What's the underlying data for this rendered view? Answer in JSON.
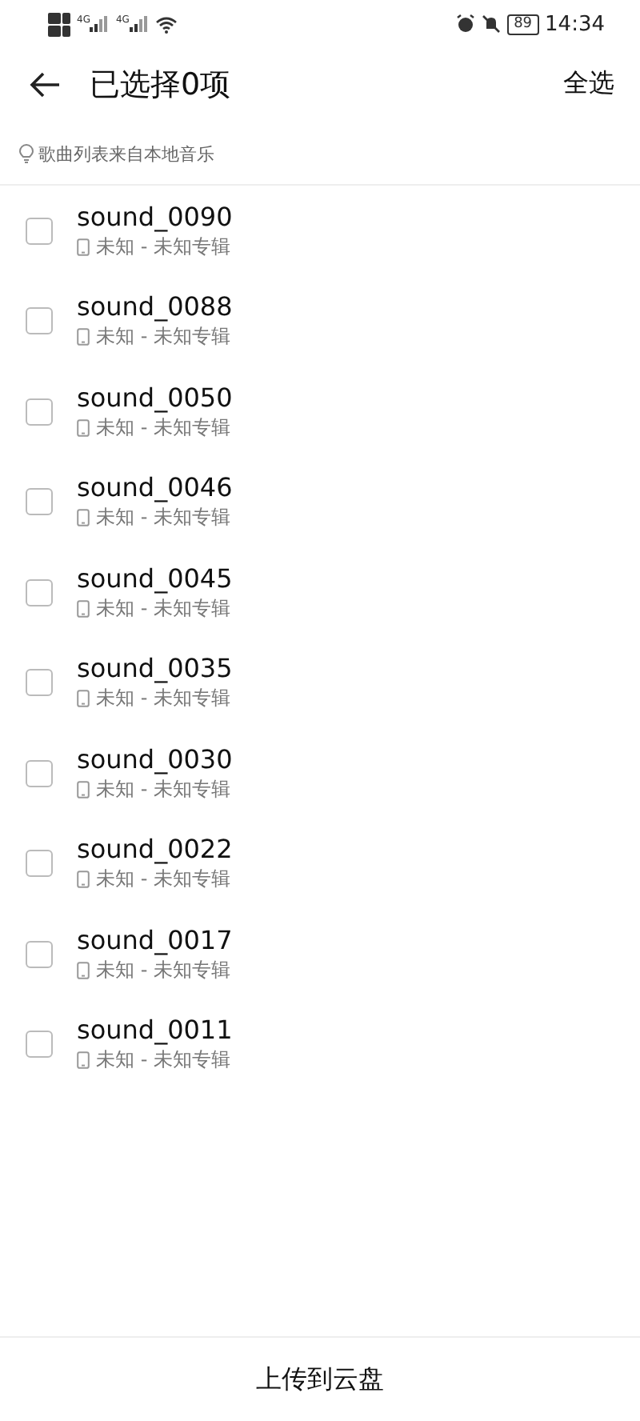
{
  "status_bar": {
    "networks": [
      "4G",
      "4G"
    ],
    "battery": "89",
    "time": "14:34"
  },
  "header": {
    "title": "已选择0项",
    "action": "全选"
  },
  "hint": "歌曲列表来自本地音乐",
  "songs": [
    {
      "title": "sound_0090",
      "subtitle": "未知 - 未知专辑",
      "checked": false
    },
    {
      "title": "sound_0088",
      "subtitle": "未知 - 未知专辑",
      "checked": false
    },
    {
      "title": "sound_0050",
      "subtitle": "未知 - 未知专辑",
      "checked": false
    },
    {
      "title": "sound_0046",
      "subtitle": "未知 - 未知专辑",
      "checked": false
    },
    {
      "title": "sound_0045",
      "subtitle": "未知 - 未知专辑",
      "checked": false
    },
    {
      "title": "sound_0035",
      "subtitle": "未知 - 未知专辑",
      "checked": false
    },
    {
      "title": "sound_0030",
      "subtitle": "未知 - 未知专辑",
      "checked": false
    },
    {
      "title": "sound_0022",
      "subtitle": "未知 - 未知专辑",
      "checked": false
    },
    {
      "title": "sound_0017",
      "subtitle": "未知 - 未知专辑",
      "checked": false
    },
    {
      "title": "sound_0011",
      "subtitle": "未知 - 未知专辑",
      "checked": false
    }
  ],
  "bottom_bar": {
    "button": "上传到云盘"
  }
}
